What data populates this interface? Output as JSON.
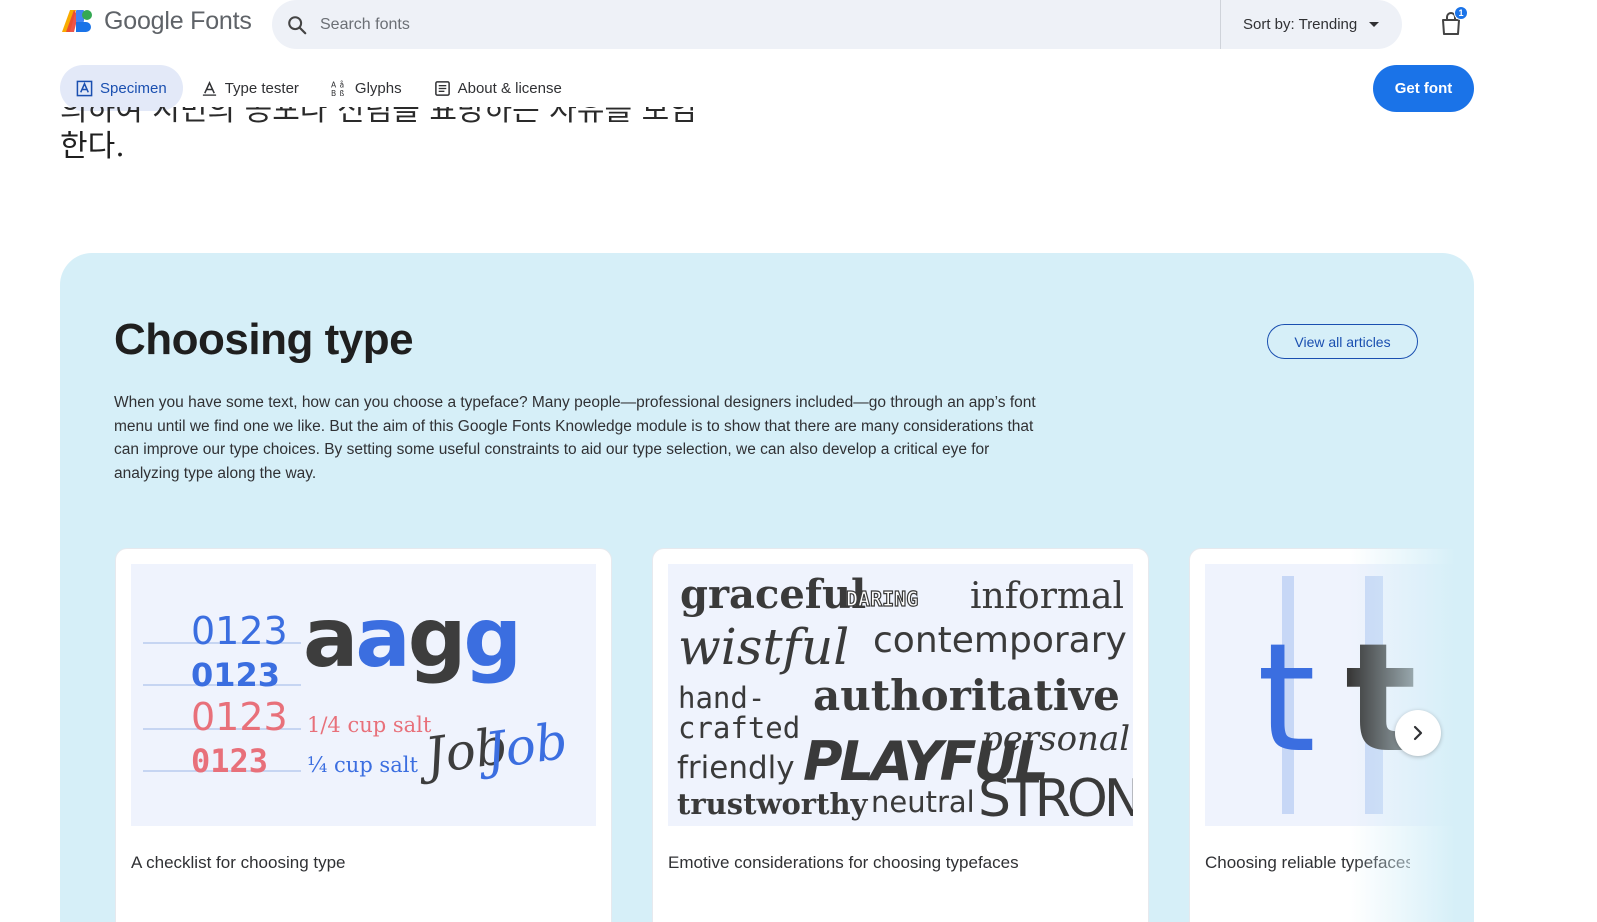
{
  "header": {
    "logo_text": "Google Fonts",
    "search_placeholder": "Search fonts",
    "sort_label": "Sort by: Trending",
    "cart_count": "1"
  },
  "tabs": [
    {
      "label": "Specimen",
      "active": true,
      "icon": "specimen-icon"
    },
    {
      "label": "Type tester",
      "active": false,
      "icon": "type-tester-icon"
    },
    {
      "label": "Glyphs",
      "active": false,
      "icon": "glyphs-icon"
    },
    {
      "label": "About & license",
      "active": false,
      "icon": "about-icon"
    }
  ],
  "get_font_label": "Get font",
  "specimen": {
    "line1": "의하여 시민의 공포나 신념을 표방하는 자유를 보임",
    "line2": "한다."
  },
  "choosing": {
    "title": "Choosing type",
    "view_all": "View all articles",
    "body": "When you have some text, how can you choose a typeface? Many people—professional designers included—go through an app’s font menu until we find one we like. But the aim of this Google Fonts Knowledge module is to show that there are many considerations that can improve our type choices. By setting some useful constraints to aid our type selection, we can also develop a critical eye for analyzing type along the way.",
    "cards": [
      {
        "caption": "A checklist for choosing type",
        "art": {
          "digits": [
            "0123",
            "0123",
            "0123",
            "0123"
          ],
          "big": "aagg",
          "frac1": "1/4 cup salt",
          "frac2": "¼ cup salt",
          "script": "Job Job"
        }
      },
      {
        "caption": "Emotive considerations for choosing typefaces",
        "art": {
          "words": [
            "graceful",
            "DARING",
            "informal",
            "wistful",
            "contemporary",
            "hand-",
            "crafted",
            "authoritative",
            "friendly",
            "PLAYFUL",
            "personal",
            "trustworthy",
            "neutral",
            "STRONG"
          ]
        }
      },
      {
        "caption": "Choosing reliable typefaces",
        "art": {
          "letters": [
            "t",
            "t"
          ]
        }
      }
    ]
  },
  "colors": {
    "accent": "#1a73e8",
    "section_bg": "#d6eff8",
    "art_blue": "#3b6ee0",
    "art_red": "#e8707a"
  }
}
